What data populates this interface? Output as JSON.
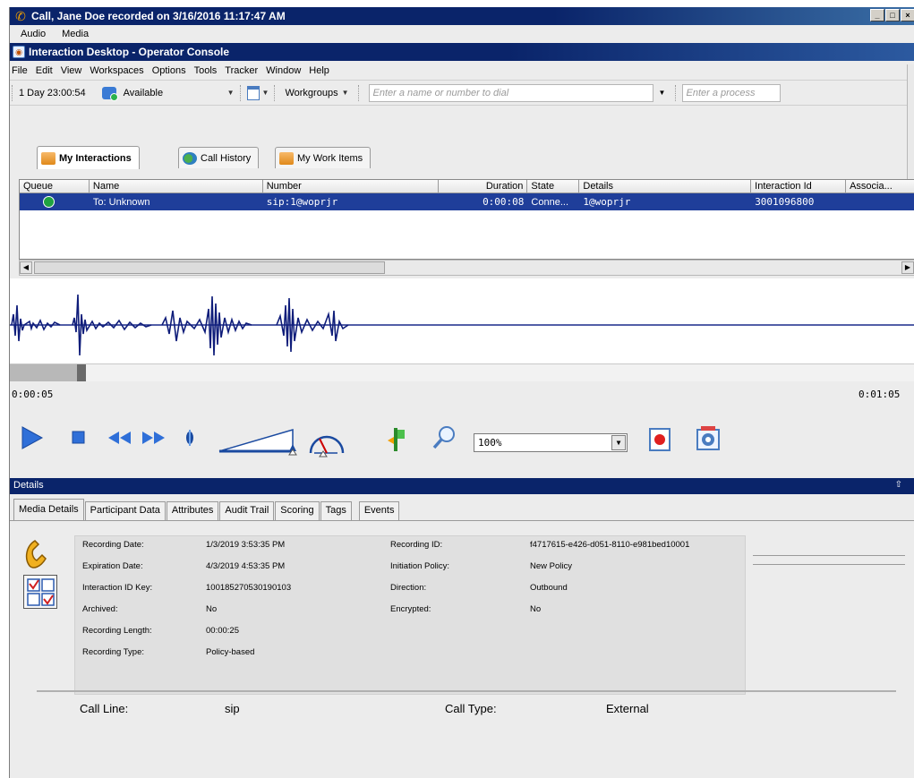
{
  "window": {
    "title": "Call, Jane Doe recorded on 3/16/2016 11:17:47 AM",
    "menu": [
      "Audio",
      "Media"
    ]
  },
  "console": {
    "title": "Interaction Desktop - Operator Console",
    "menu": [
      "File",
      "Edit",
      "View",
      "Workspaces",
      "Options",
      "Tools",
      "Tracker",
      "Window",
      "Help"
    ]
  },
  "toolbar": {
    "duration": "1 Day 23:00:54",
    "status": "Available",
    "workgroups": "Workgroups",
    "dial_placeholder": "Enter a name or number to dial",
    "process_placeholder": "Enter a process"
  },
  "tabs": [
    {
      "label": "My Interactions",
      "icon": "interactions-icon",
      "active": true
    },
    {
      "label": "Call History",
      "icon": "call-history-icon",
      "active": false
    },
    {
      "label": "My Work Items",
      "icon": "work-items-icon",
      "active": false
    }
  ],
  "table": {
    "columns": [
      "Queue",
      "Name",
      "Number",
      "Duration",
      "State",
      "Details",
      "Interaction Id",
      "Associa..."
    ],
    "rows": [
      {
        "name": "To: Unknown",
        "number": "sip:1@woprjr",
        "duration": "0:00:08",
        "state": "Conne...",
        "details": "1@woprjr",
        "interaction_id": "3001096800",
        "association": ""
      }
    ]
  },
  "player": {
    "time_current": "0:00:05",
    "time_total": "0:01:05",
    "zoom": "100%"
  },
  "details": {
    "title": "Details",
    "tabs": [
      "Media Details",
      "Participant Data",
      "Attributes",
      "Audit Trail",
      "Scoring",
      "Tags",
      "Events"
    ],
    "left": [
      {
        "label": "Recording Date:",
        "value": "1/3/2019 3:53:35 PM"
      },
      {
        "label": "Expiration Date:",
        "value": "4/3/2019 4:53:35 PM"
      },
      {
        "label": "Interaction ID Key:",
        "value": "100185270530190103"
      },
      {
        "label": "Archived:",
        "value": "No"
      },
      {
        "label": "Recording Length:",
        "value": "00:00:25"
      },
      {
        "label": "Recording Type:",
        "value": "Policy-based"
      }
    ],
    "right": [
      {
        "label": "Recording ID:",
        "value": "f4717615-e426-d051-8110-e981bed10001"
      },
      {
        "label": "Initiation Policy:",
        "value": "New Policy"
      },
      {
        "label": "Direction:",
        "value": "Outbound"
      },
      {
        "label": "Encrypted:",
        "value": "No"
      }
    ],
    "footer": {
      "call_line_label": "Call Line:",
      "call_line_value": "sip",
      "call_type_label": "Call Type:",
      "call_type_value": "External"
    }
  }
}
